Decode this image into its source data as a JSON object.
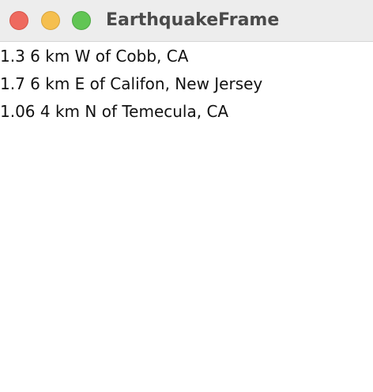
{
  "window": {
    "title": "EarthquakeFrame"
  },
  "earthquakes": [
    {
      "text": "1.3 6 km W of Cobb, CA"
    },
    {
      "text": "1.7 6 km E of Califon, New Jersey"
    },
    {
      "text": "1.06 4 km N of Temecula, CA"
    }
  ]
}
